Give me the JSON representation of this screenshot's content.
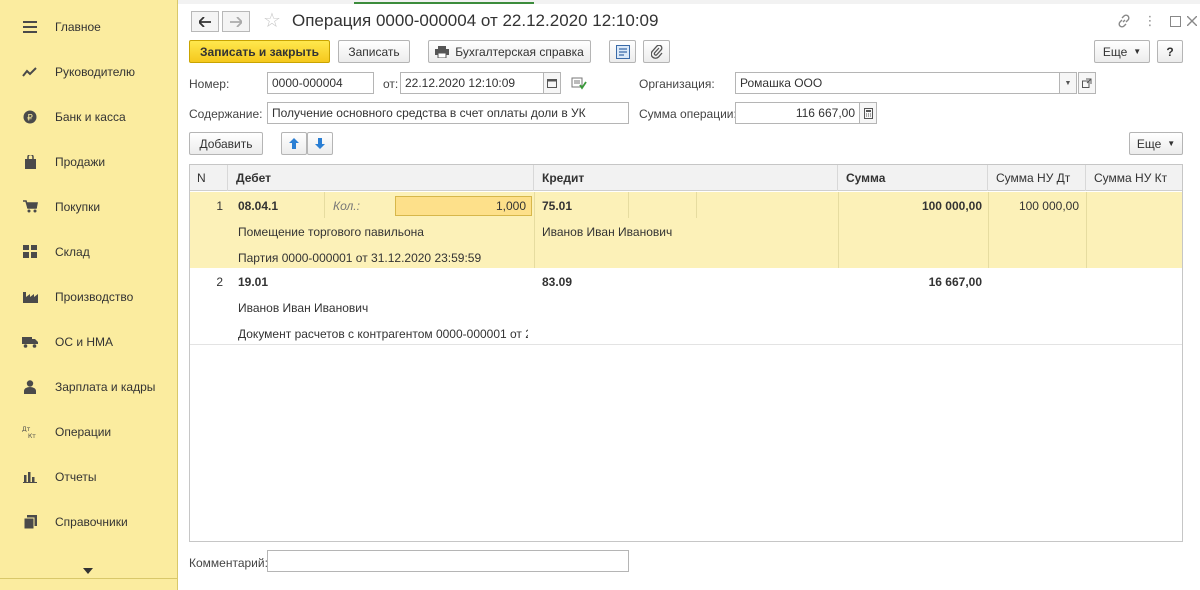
{
  "sidebar": {
    "items": [
      {
        "label": "Главное",
        "icon": "menu-icon"
      },
      {
        "label": "Руководителю",
        "icon": "trend-icon"
      },
      {
        "label": "Банк и касса",
        "icon": "ruble-coin-icon"
      },
      {
        "label": "Продажи",
        "icon": "shopping-bag-icon"
      },
      {
        "label": "Покупки",
        "icon": "cart-icon"
      },
      {
        "label": "Склад",
        "icon": "warehouse-grid-icon"
      },
      {
        "label": "Производство",
        "icon": "factory-icon"
      },
      {
        "label": "ОС и НМА",
        "icon": "truck-icon"
      },
      {
        "label": "Зарплата и кадры",
        "icon": "person-icon"
      },
      {
        "label": "Операции",
        "icon": "dt-kt-icon"
      },
      {
        "label": "Отчеты",
        "icon": "bar-chart-icon"
      },
      {
        "label": "Справочники",
        "icon": "books-icon"
      }
    ]
  },
  "header": {
    "title": "Операция 0000-000004 от 22.12.2020 12:10:09"
  },
  "toolbar": {
    "save_close": "Записать и закрыть",
    "save": "Записать",
    "accounting_note": "Бухгалтерская справка",
    "more": "Еще",
    "help": "?"
  },
  "form": {
    "number_label": "Номер:",
    "number_value": "0000-000004",
    "date_label": "от:",
    "date_value": "22.12.2020 12:10:09",
    "org_label": "Организация:",
    "org_value": "Ромашка ООО",
    "content_label": "Содержание:",
    "content_value": "Получение основного средства в счет оплаты доли в УК",
    "sum_label": "Сумма операции:",
    "sum_value": "116 667,00",
    "comment_label": "Комментарий:",
    "comment_value": ""
  },
  "table_toolbar": {
    "add": "Добавить",
    "more": "Еще"
  },
  "table": {
    "headers": {
      "n": "N",
      "debit": "Дебет",
      "credit": "Кредит",
      "sum": "Сумма",
      "nu_dt": "Сумма НУ Дт",
      "nu_kt": "Сумма НУ Кт"
    },
    "rows": [
      {
        "n": "1",
        "debit_account": "08.04.1",
        "qty_label": "Кол.:",
        "qty_value": "1,000",
        "debit_sub1": "Помещение торгового павильона",
        "debit_sub2": "Партия 0000-000001 от 31.12.2020 23:59:59",
        "credit_account": "75.01",
        "credit_sub1": "Иванов Иван Иванович",
        "sum": "100 000,00",
        "nu_dt": "100 000,00"
      },
      {
        "n": "2",
        "debit_account": "19.01",
        "debit_sub1": "Иванов Иван Иванович",
        "debit_sub2": "Документ расчетов с контрагентом 0000-000001 от 2...",
        "credit_account": "83.09",
        "sum": "16 667,00"
      }
    ]
  }
}
